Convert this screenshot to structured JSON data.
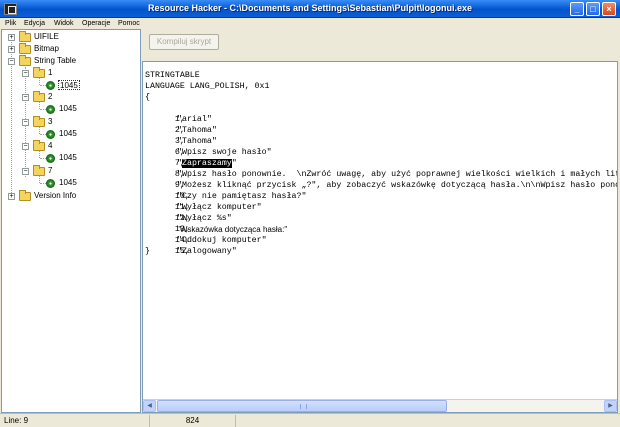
{
  "window": {
    "title": "Resource Hacker  -  C:\\Documents and Settings\\Sebastian\\Pulpit\\logonui.exe",
    "minimize_glyph": "_",
    "maximize_glyph": "□",
    "close_glyph": "×"
  },
  "menu": {
    "items": [
      "Plik",
      "Edycja",
      "Widok",
      "Operacje",
      "Pomoc"
    ]
  },
  "tree": {
    "expanded_glyph": "−",
    "collapsed_glyph": "+",
    "nodes": [
      {
        "label": "UIFILE",
        "icon": "folder-icon",
        "expander": "+"
      },
      {
        "label": "Bitmap",
        "icon": "folder-icon",
        "expander": "+"
      },
      {
        "label": "String Table",
        "icon": "folder-icon",
        "expander": "−"
      },
      {
        "label": "1",
        "icon": "folder-icon",
        "expander": "−"
      },
      {
        "label": "1045",
        "icon": "gear-icon",
        "selected": true
      },
      {
        "label": "2",
        "icon": "folder-icon",
        "expander": "−"
      },
      {
        "label": "1045",
        "icon": "gear-icon"
      },
      {
        "label": "3",
        "icon": "folder-icon",
        "expander": "−"
      },
      {
        "label": "1045",
        "icon": "gear-icon"
      },
      {
        "label": "4",
        "icon": "folder-icon",
        "expander": "−"
      },
      {
        "label": "1045",
        "icon": "gear-icon"
      },
      {
        "label": "7",
        "icon": "folder-icon",
        "expander": "−"
      },
      {
        "label": "1045",
        "icon": "gear-icon"
      },
      {
        "label": "Version Info",
        "icon": "folder-icon",
        "expander": "+"
      }
    ]
  },
  "toolbar": {
    "compile_label": "Kompiluj skrypt"
  },
  "editor": {
    "header1": "STRINGTABLE",
    "header2": "LANGUAGE LANG_POLISH, 0x1",
    "open_brace": "{",
    "close_brace": "}",
    "lines": [
      {
        "id": "1,",
        "text": "\"arial\""
      },
      {
        "id": "2,",
        "text": "\"Tahoma\""
      },
      {
        "id": "3,",
        "text": "\"Tahoma\""
      },
      {
        "id": "6,",
        "text": "\"Wpisz swoje hasło\""
      },
      {
        "id": "7,",
        "pre": "\"",
        "highlight": "Zapraszamy",
        "post": "\""
      },
      {
        "id": "8,",
        "text": "\"Wpisz hasło ponownie.  \\nZwróć uwagę, aby użyć poprawnej wielkości wielkich i małych liter.\""
      },
      {
        "id": "9,",
        "text": "\"Możesz kliknąć przycisk „?\", aby zobaczyć wskazówkę dotyczącą hasła.\\n\\nWpisz hasło ponownie.\\n\\nZwróć uwagę\""
      },
      {
        "id": "10,",
        "text": "\"Czy nie pamiętasz hasła?\""
      },
      {
        "id": "11,",
        "text": "\"Wyłącz komputer\""
      },
      {
        "id": "12,",
        "text": "\"Wyłącz %s\""
      },
      {
        "id": "13,",
        "text": "\"Wskazówka dotycząca hasła:\""
      },
      {
        "id": "14,",
        "text": "\"Oddokuj komputer\""
      },
      {
        "id": "15,",
        "text": "\"Zalogowany\""
      }
    ]
  },
  "scrollbar": {
    "left_glyph": "◀",
    "right_glyph": "▶"
  },
  "status": {
    "line": "Line: 9",
    "position": "824"
  }
}
